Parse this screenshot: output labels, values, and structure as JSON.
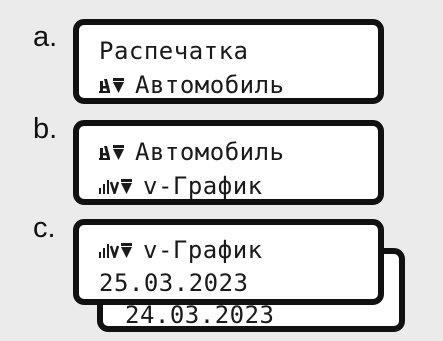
{
  "steps": [
    {
      "label": "a.",
      "line1": {
        "text": "Распечатка"
      },
      "line2": {
        "icon": "print-vehicle-icon",
        "text": "Автомобиль"
      }
    },
    {
      "label": "b.",
      "line1": {
        "icon": "print-vehicle-icon",
        "text": "Автомобиль"
      },
      "line2": {
        "icon": "speed-graph-print-icon",
        "text": "v-График"
      }
    },
    {
      "label": "c.",
      "line1": {
        "icon": "speed-graph-print-icon",
        "text": "v-График"
      },
      "line2": {
        "text": "25.03.2023"
      },
      "back_date": "24.03.2023"
    }
  ]
}
